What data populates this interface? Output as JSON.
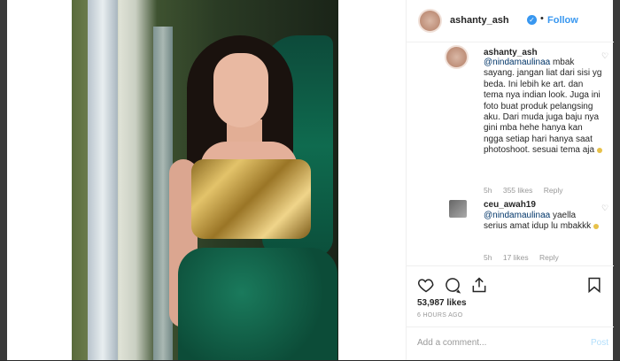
{
  "post": {
    "username": "ashanty_ash",
    "follow_label": "Follow",
    "separator": "•"
  },
  "comments": [
    {
      "username": "ashanty_ash",
      "mention": "@nindamaulinaa",
      "text": " mbak sayang. jangan liat dari sisi yg beda. Ini lebih ke art. dan tema nya indian look. Juga ini foto buat produk pelangsing aku. Dari muda juga baju nya gini mba hehe hanya kan ngga setiap hari hanya saat photoshoot. sesuai tema aja",
      "age": "5h",
      "likes": "355 likes",
      "reply": "Reply"
    },
    {
      "username": "ceu_awah19",
      "mention": "@nindamaulinaa",
      "text": " yaella serius amat idup lu mbakkk",
      "age": "5h",
      "likes": "17 likes",
      "reply": "Reply"
    }
  ],
  "actions": {
    "likes": "53,987 likes",
    "time": "6 HOURS AGO",
    "add_comment_placeholder": "Add a comment...",
    "post_label": "Post"
  },
  "icons": {
    "like": "heart-icon",
    "comment": "comment-icon",
    "share": "share-icon",
    "save": "bookmark-icon"
  },
  "colors": {
    "link": "#3897f0",
    "text": "#262626",
    "meta": "#999999"
  }
}
